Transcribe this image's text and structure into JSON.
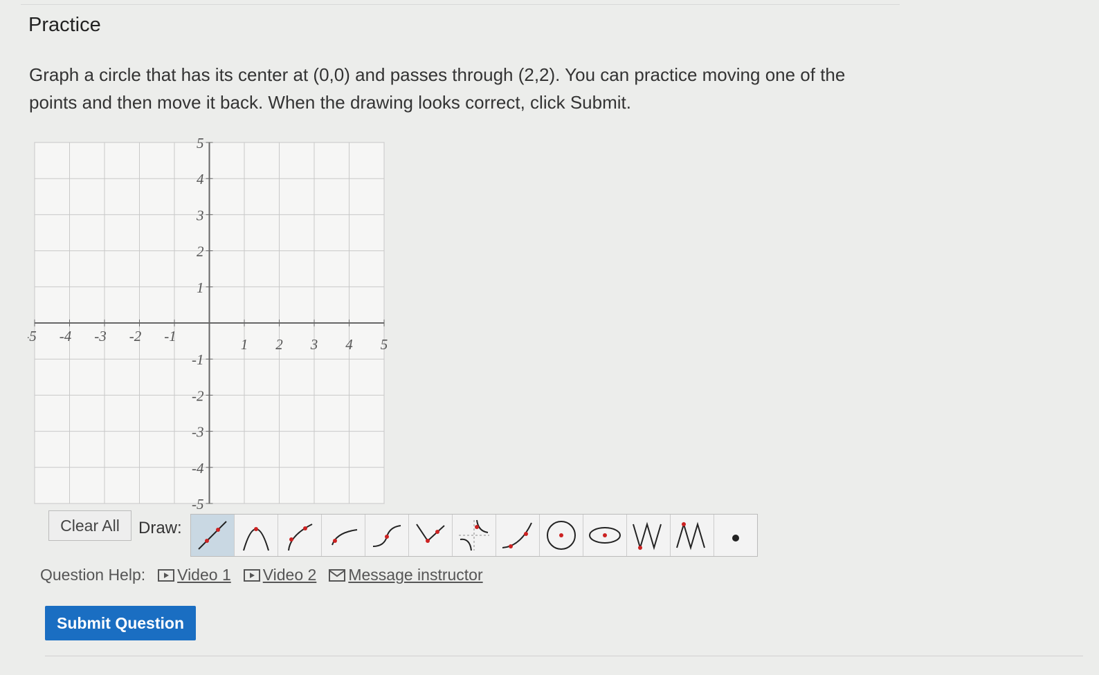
{
  "page": {
    "title": "Practice",
    "prompt": "Graph a circle that has its center at (0,0) and passes through (2,2). You can practice moving one of the points and then move it back. When the drawing looks correct, click Submit."
  },
  "graph": {
    "x_range": [
      -5,
      5
    ],
    "y_range": [
      -5,
      5
    ],
    "x_tick_labels": [
      "-5",
      "-4",
      "-3",
      "-2",
      "-1",
      "1",
      "2",
      "3",
      "4",
      "5"
    ],
    "y_tick_labels": [
      "5",
      "4",
      "3",
      "2",
      "1",
      "-1",
      "-2",
      "-3",
      "-4",
      "-5"
    ],
    "grid": true
  },
  "toolbar": {
    "clear_all_label": "Clear All",
    "draw_label": "Draw:",
    "tools": [
      {
        "name": "line-tool-icon",
        "selected": true
      },
      {
        "name": "parabola-tool-icon",
        "selected": false
      },
      {
        "name": "sqrt-tool-icon",
        "selected": false
      },
      {
        "name": "log-tool-icon",
        "selected": false
      },
      {
        "name": "cubic-tool-icon",
        "selected": false
      },
      {
        "name": "absolute-value-tool-icon",
        "selected": false
      },
      {
        "name": "rational-tool-icon",
        "selected": false
      },
      {
        "name": "exponential-tool-icon",
        "selected": false
      },
      {
        "name": "circle-tool-icon",
        "selected": false
      },
      {
        "name": "ellipse-tool-icon",
        "selected": false
      },
      {
        "name": "sine-tool-icon",
        "selected": false
      },
      {
        "name": "cosine-tool-icon",
        "selected": false
      },
      {
        "name": "point-tool-icon",
        "selected": false
      }
    ]
  },
  "help": {
    "label": "Question Help:",
    "video1": "Video 1",
    "video2": "Video 2",
    "message": "Message instructor"
  },
  "submit_label": "Submit Question",
  "colors": {
    "accent": "#1a6ec2",
    "curve": "#222222",
    "point": "#cc2222",
    "grid": "#c8c8c8"
  }
}
